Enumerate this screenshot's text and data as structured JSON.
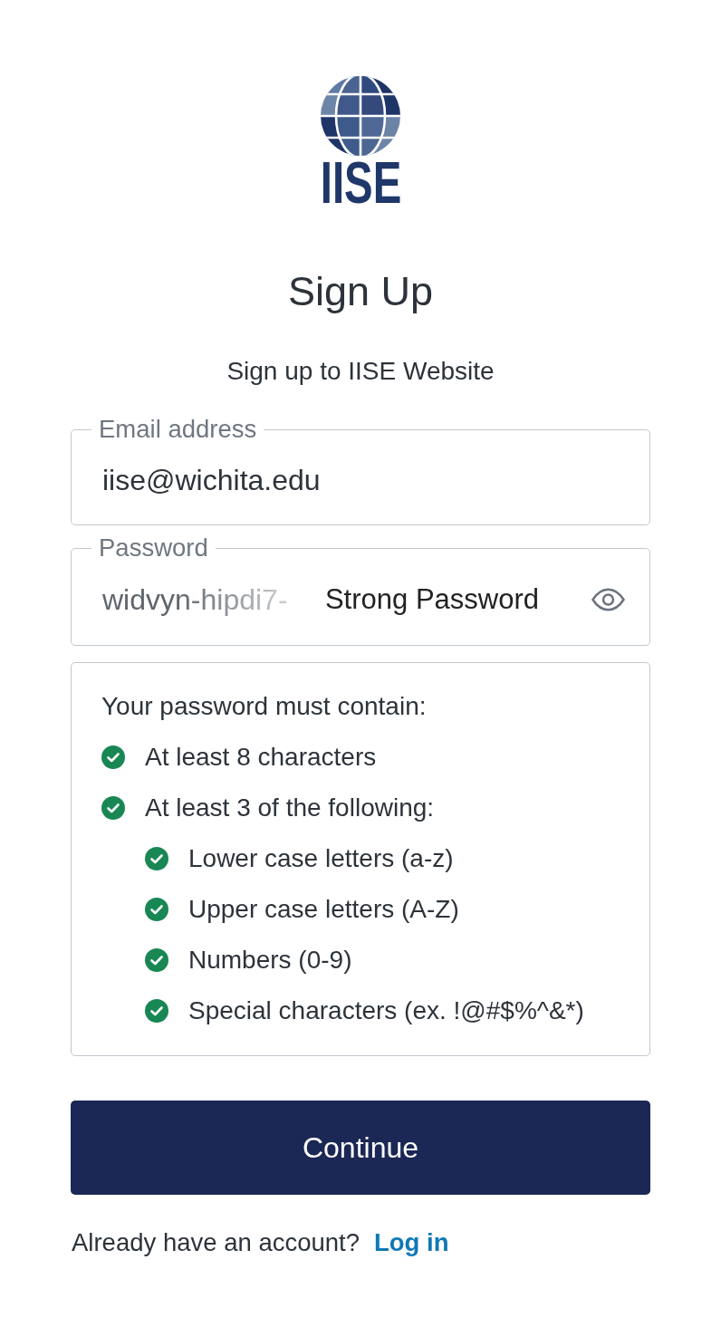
{
  "logo": {
    "text": "IISE"
  },
  "title": "Sign Up",
  "subtitle": "Sign up to IISE Website",
  "email_field": {
    "label": "Email address",
    "value": "iise@wichita.edu"
  },
  "password_field": {
    "label": "Password",
    "value": "widvyn-hipdi7-",
    "suggestion": "Strong Password"
  },
  "requirements": {
    "heading": "Your password must contain:",
    "items": [
      {
        "text": "At least 8 characters",
        "met": true
      },
      {
        "text": "At least 3 of the following:",
        "met": true,
        "children": [
          {
            "text": "Lower case letters (a-z)",
            "met": true
          },
          {
            "text": "Upper case letters (A-Z)",
            "met": true
          },
          {
            "text": "Numbers (0-9)",
            "met": true
          },
          {
            "text": "Special characters (ex. !@#$%^&*)",
            "met": true
          }
        ]
      }
    ]
  },
  "continue_button": "Continue",
  "footer": {
    "prompt": "Already have an account?",
    "link": "Log in"
  }
}
